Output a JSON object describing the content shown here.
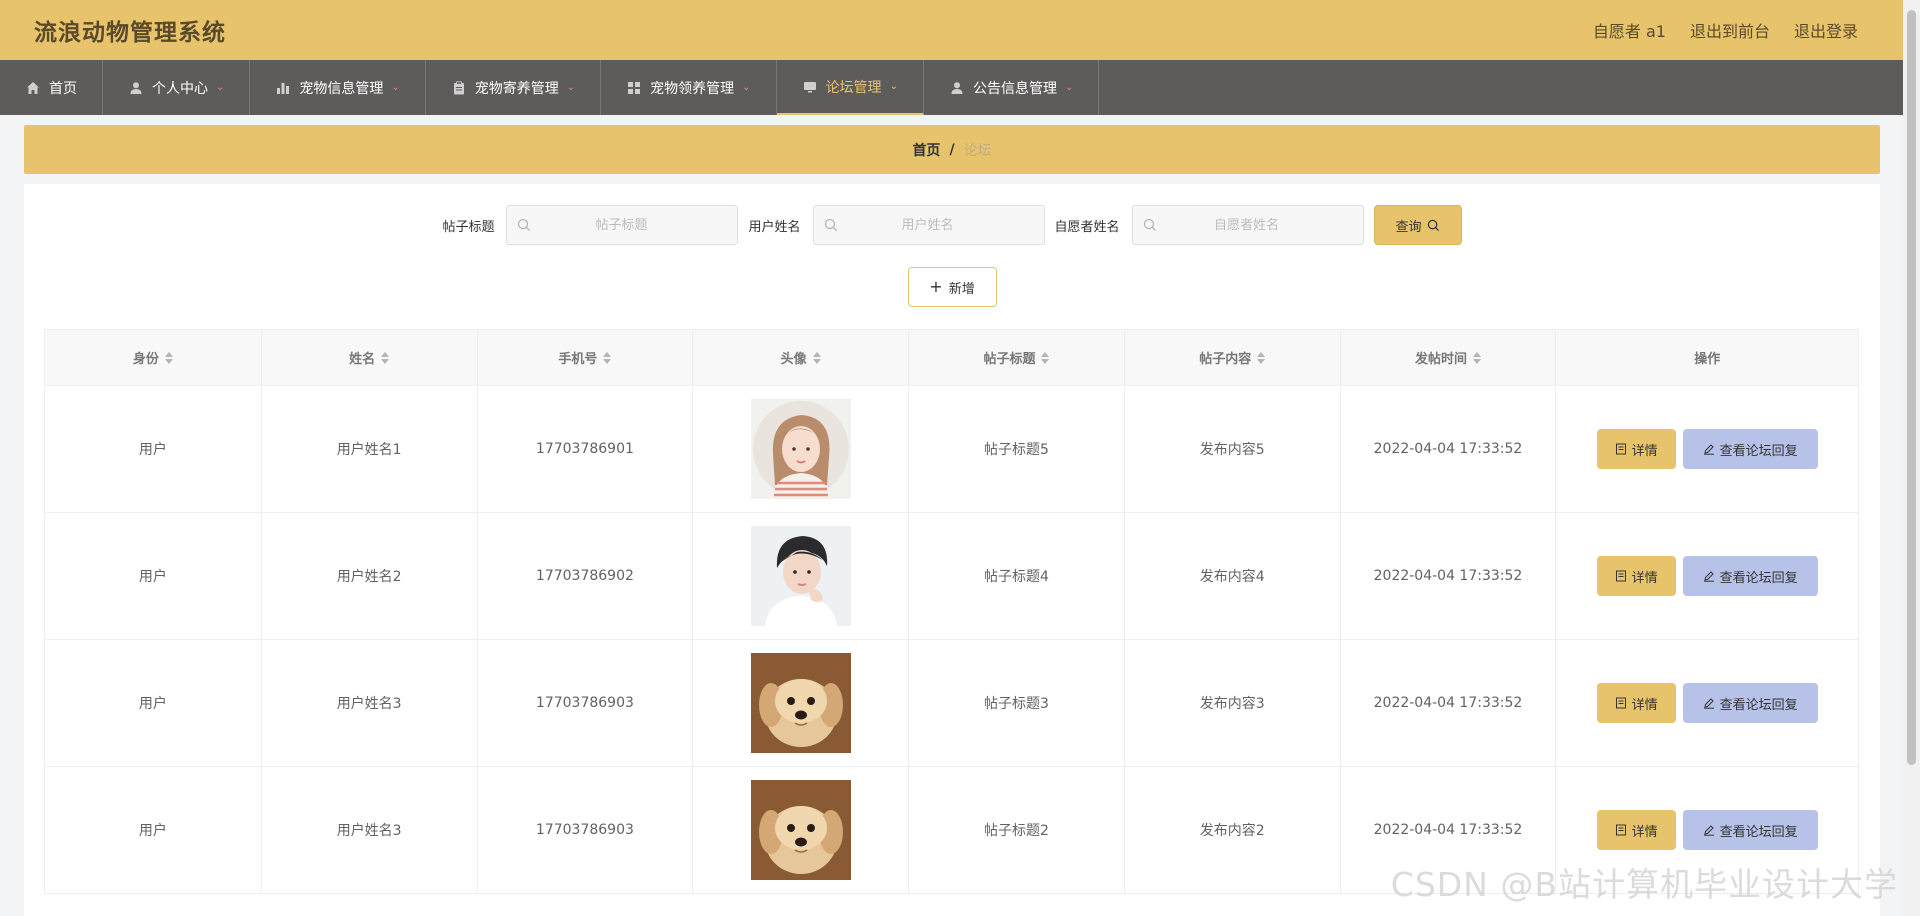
{
  "header": {
    "title": "流浪动物管理系统",
    "links": [
      "自愿者 a1",
      "退出到前台",
      "退出登录"
    ]
  },
  "nav": [
    {
      "label": "首页",
      "icon": "home-icon",
      "dropdown": false,
      "active": false
    },
    {
      "label": "个人中心",
      "icon": "user-icon",
      "dropdown": true,
      "active": false
    },
    {
      "label": "宠物信息管理",
      "icon": "bar-chart-icon",
      "dropdown": true,
      "active": false
    },
    {
      "label": "宠物寄养管理",
      "icon": "clipboard-icon",
      "dropdown": true,
      "active": false
    },
    {
      "label": "宠物领养管理",
      "icon": "grid-icon",
      "dropdown": true,
      "active": false
    },
    {
      "label": "论坛管理",
      "icon": "monitor-icon",
      "dropdown": true,
      "active": true
    },
    {
      "label": "公告信息管理",
      "icon": "user-icon",
      "dropdown": true,
      "active": false
    }
  ],
  "breadcrumb": {
    "home": "首页",
    "separator": "/",
    "current": "论坛"
  },
  "search": {
    "fields": [
      {
        "label": "帖子标题",
        "placeholder": "帖子标题"
      },
      {
        "label": "用户姓名",
        "placeholder": "用户姓名"
      },
      {
        "label": "自愿者姓名",
        "placeholder": "自愿者姓名"
      }
    ],
    "query_label": "查询"
  },
  "add_label": "新增",
  "table": {
    "columns": [
      "身份",
      "姓名",
      "手机号",
      "头像",
      "帖子标题",
      "帖子内容",
      "发帖时间",
      "操作"
    ],
    "rows": [
      {
        "identity": "用户",
        "name": "用户姓名1",
        "phone": "17703786901",
        "avatar": "girl-avatar",
        "title": "帖子标题5",
        "content": "发布内容5",
        "time": "2022-04-04 17:33:52"
      },
      {
        "identity": "用户",
        "name": "用户姓名2",
        "phone": "17703786902",
        "avatar": "boy-avatar",
        "title": "帖子标题4",
        "content": "发布内容4",
        "time": "2022-04-04 17:33:52"
      },
      {
        "identity": "用户",
        "name": "用户姓名3",
        "phone": "17703786903",
        "avatar": "puppy-avatar",
        "title": "帖子标题3",
        "content": "发布内容3",
        "time": "2022-04-04 17:33:52"
      },
      {
        "identity": "用户",
        "name": "用户姓名3",
        "phone": "17703786903",
        "avatar": "puppy-avatar",
        "title": "帖子标题2",
        "content": "发布内容2",
        "time": "2022-04-04 17:33:52"
      }
    ],
    "actions": {
      "detail": "详情",
      "reply": "查看论坛回复"
    }
  },
  "watermark": "CSDN @B站计算机毕业设计大学",
  "colors": {
    "accent": "#e7c46c",
    "nav_bg": "#5e5b5b",
    "reply_btn": "#b7c2e8"
  }
}
